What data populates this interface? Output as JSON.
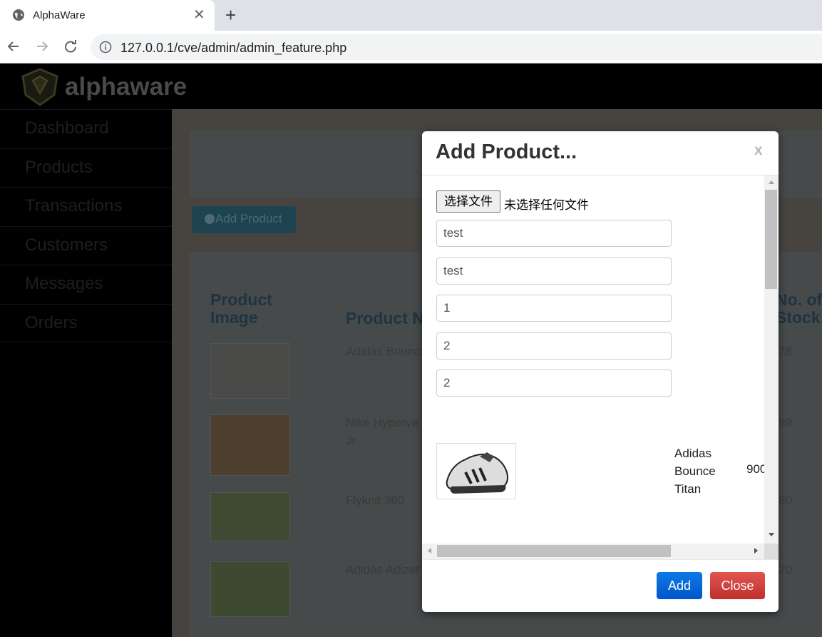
{
  "browser": {
    "tab_title": "AlphaWare",
    "url": "127.0.0.1/cve/admin/admin_feature.php"
  },
  "page": {
    "brand": "alphaware",
    "sidebar": [
      "Dashboard",
      "Products",
      "Transactions",
      "Customers",
      "Messages",
      "Orders"
    ],
    "add_product_button": "Add Product",
    "table": {
      "headers": {
        "image": "Product Image",
        "name": "Product N",
        "stock": "No. of Stock"
      },
      "rows": [
        {
          "name": "Adidas Bounce",
          "stock": "78"
        },
        {
          "name": "Nike Hyperve Jr.",
          "stock": "89"
        },
        {
          "name": "Flyknit 360",
          "stock": "80"
        },
        {
          "name": "Adidas Adizer",
          "stock": "20"
        }
      ]
    }
  },
  "modal": {
    "title": "Add Product...",
    "close_x": "x",
    "file_button": "选择文件",
    "file_label": "未选择任何文件",
    "inputs": [
      "test",
      "test",
      "1",
      "2",
      "2"
    ],
    "preview_name": "Adidas Bounce Titan",
    "preview_price": "900",
    "add_button": "Add",
    "close_button": "Close"
  }
}
